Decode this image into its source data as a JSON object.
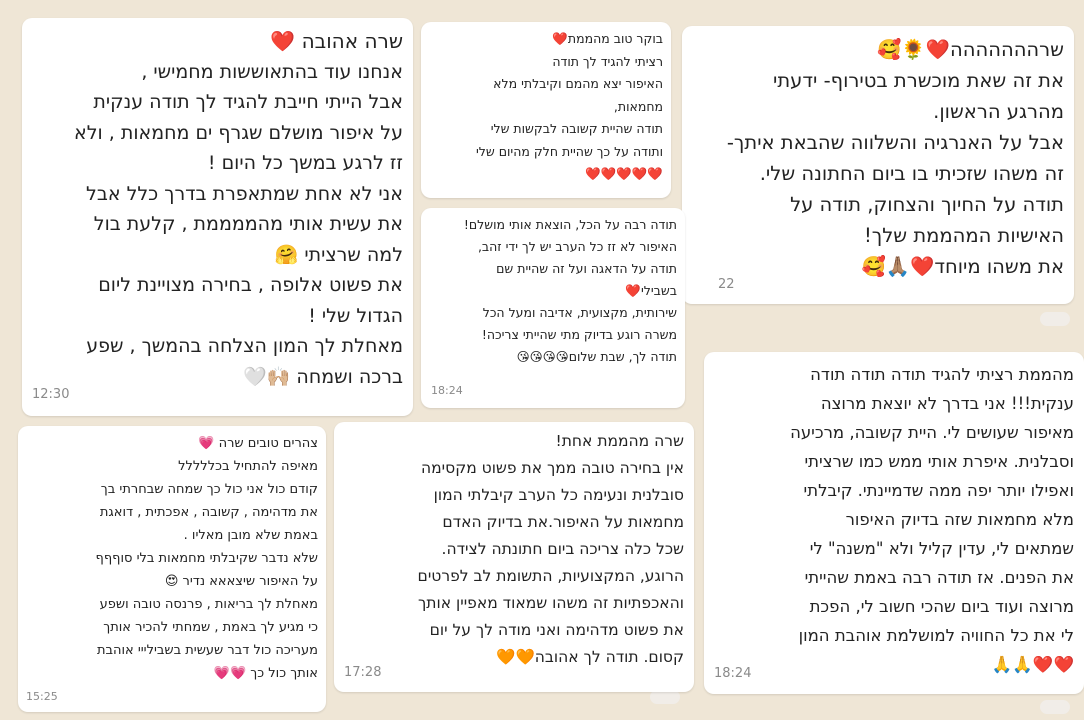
{
  "bubbles": [
    {
      "lines": [
        "שרה אהובה ❤️",
        "אנחנו עוד בהתאוששות מחמישי ,",
        "אבל הייתי חייבת להגיד לך תודה ענקית",
        "על איפור מושלם שגרף ים מחמאות , ולא",
        "זז לרגע במשך כל היום !",
        "אני לא אחת שמתאפרת בדרך כלל אבל",
        "את עשית אותי  מהממממת , קלעת בול",
        "למה שרציתי 🤗",
        "את פשוט אלופה , בחירה מצויינת ליום",
        "הגדול שלי !",
        "מאחלת לך המון הצלחה בהמשך , שפע",
        "ברכה ושמחה 🙌🏼🤍"
      ],
      "time": "12:30"
    },
    {
      "lines": [
        "בוקר טוב מהממת❤️",
        "רציתי להגיד לך תודה",
        "האיפור יצא מהמם וקיבלתי מלא",
        "מחמאות,",
        "תודה שהיית קשובה לבקשות שלי",
        "ותודה על כך שהיית חלק מהיום שלי",
        "❤️❤️❤️❤️❤️"
      ],
      "time": ""
    },
    {
      "lines": [
        "שרההההההה❤️🌻🥰",
        "את זה שאת מוכשרת בטירוף- ידעתי",
        "מהרגע הראשון.",
        "אבל על האנרגיה והשלווה שהבאת איתך-",
        "זה משהו שזכיתי בו ביום החתונה שלי.",
        "תודה על החיוך והצחוק, תודה על",
        "האישיות המהממת שלך!",
        "את משהו מיוחד❤️🙏🏽🥰"
      ],
      "time": "22"
    },
    {
      "lines": [
        "תודה רבה על הכל, הוצאת אותי מושלם!",
        "האיפור לא זז כל הערב יש לך ידי זהב,",
        "תודה על הדאגה ועל זה שהיית שם",
        "בשבילי❤️",
        "שירותית, מקצועית, אדיבה ומעל הכל",
        "משרה רוגע בדיוק מתי שהייתי צריכה!",
        "תודה לך, שבת שלום😘😘😘😘"
      ],
      "time": "18:24"
    },
    {
      "lines": [
        "צהרים טובים שרה 💗",
        "מאיפה להתחיל בכללללל",
        "קודם כול אני כול כך שמחה שבחרתי בך",
        "את מדהימה , קשובה , אפכתית , דואגת",
        "באמת שלא מובן מאליו .",
        "שלא נדבר שקיבלתי מחמאות בלי סוףףף",
        "על האיפור שיצאאא נדיר 😍",
        "מאחלת לך בריאות , פרנסה טובה ושפע",
        "כי מגיע לך באמת , שמחתי להכיר אותך",
        "מעריכה כול דבר שעשית בשבילייי אוהבת",
        "אותך כול כך 💗💗"
      ],
      "time": "15:25"
    },
    {
      "lines": [
        "שרה מהממת אחת!",
        "אין בחירה טובה ממך את פשוט מקסימה",
        "סובלנית ונעימה כל הערב קיבלתי המון",
        "מחמאות על האיפור.את בדיוק האדם",
        "שכל כלה צריכה ביום חתונתה לצידה.",
        "הרוגע, המקצועיות, התשומת לב לפרטים",
        "והאכפתיות זה משהו שמאוד מאפיין אותך",
        "את פשוט מדהימה ואני מודה לך על יום",
        "קסום. תודה לך אהובה🧡🧡"
      ],
      "time": "17:28"
    },
    {
      "lines": [
        "מהממת רציתי להגיד תודה תודה תודה",
        "ענקית!!! אני בדרך לא יוצאת מרוצה",
        "מאיפור שעושים לי. היית קשובה, מרכיעה",
        "וסבלנית. איפרת אותי ממש כמו שרציתי",
        "ואפילו יותר יפה ממה שדמיינתי. קיבלתי",
        "מלא מחמאות שזה בדיוק האיפור",
        "שמתאים לי, עדין קליל ולא \"משנה\" לי",
        "את הפנים. אז תודה רבה באמת שהייתי",
        "מרוצה ועוד ביום שהכי חשוב לי, הפכת",
        "לי את כל החוויה למושלמת אוהבת המון",
        "❤️❤️🙏🙏"
      ],
      "time": "18:24"
    }
  ]
}
